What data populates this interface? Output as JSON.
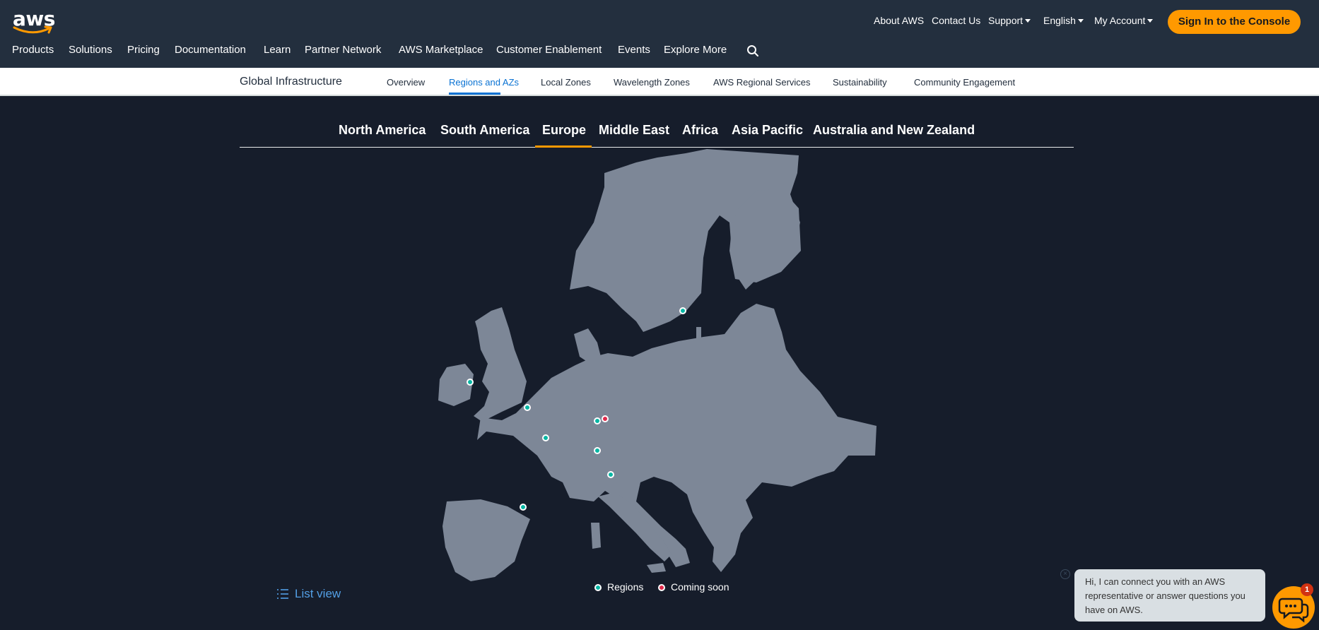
{
  "header": {
    "logo_text": "aws",
    "utility_links": [
      "About AWS",
      "Contact Us",
      "Support",
      "English",
      "My Account"
    ],
    "sign_in_label": "Sign In to the Console",
    "main_nav": [
      "Products",
      "Solutions",
      "Pricing",
      "Documentation",
      "Learn",
      "Partner Network",
      "AWS Marketplace",
      "Customer Enablement",
      "Events",
      "Explore More"
    ]
  },
  "subnav": {
    "title": "Global Infrastructure",
    "links": [
      "Overview",
      "Regions and AZs",
      "Local Zones",
      "Wavelength Zones",
      "AWS Regional Services",
      "Sustainability",
      "Community Engagement"
    ],
    "active": "Regions and AZs"
  },
  "region_tabs": {
    "items": [
      "North America",
      "South America",
      "Europe",
      "Middle East",
      "Africa",
      "Asia Pacific",
      "Australia and New Zealand"
    ],
    "active": "Europe"
  },
  "map": {
    "legend": {
      "regions": "Regions",
      "coming_soon": "Coming soon"
    },
    "colors": {
      "land": "#7d8797",
      "region": "#06b6a4",
      "coming_soon": "#e0294b",
      "background": "#161d2b"
    }
  },
  "list_view_label": "List view",
  "chat": {
    "message": "Hi, I can connect you with an AWS representative or answer questions you have on AWS.",
    "badge_count": "1"
  }
}
